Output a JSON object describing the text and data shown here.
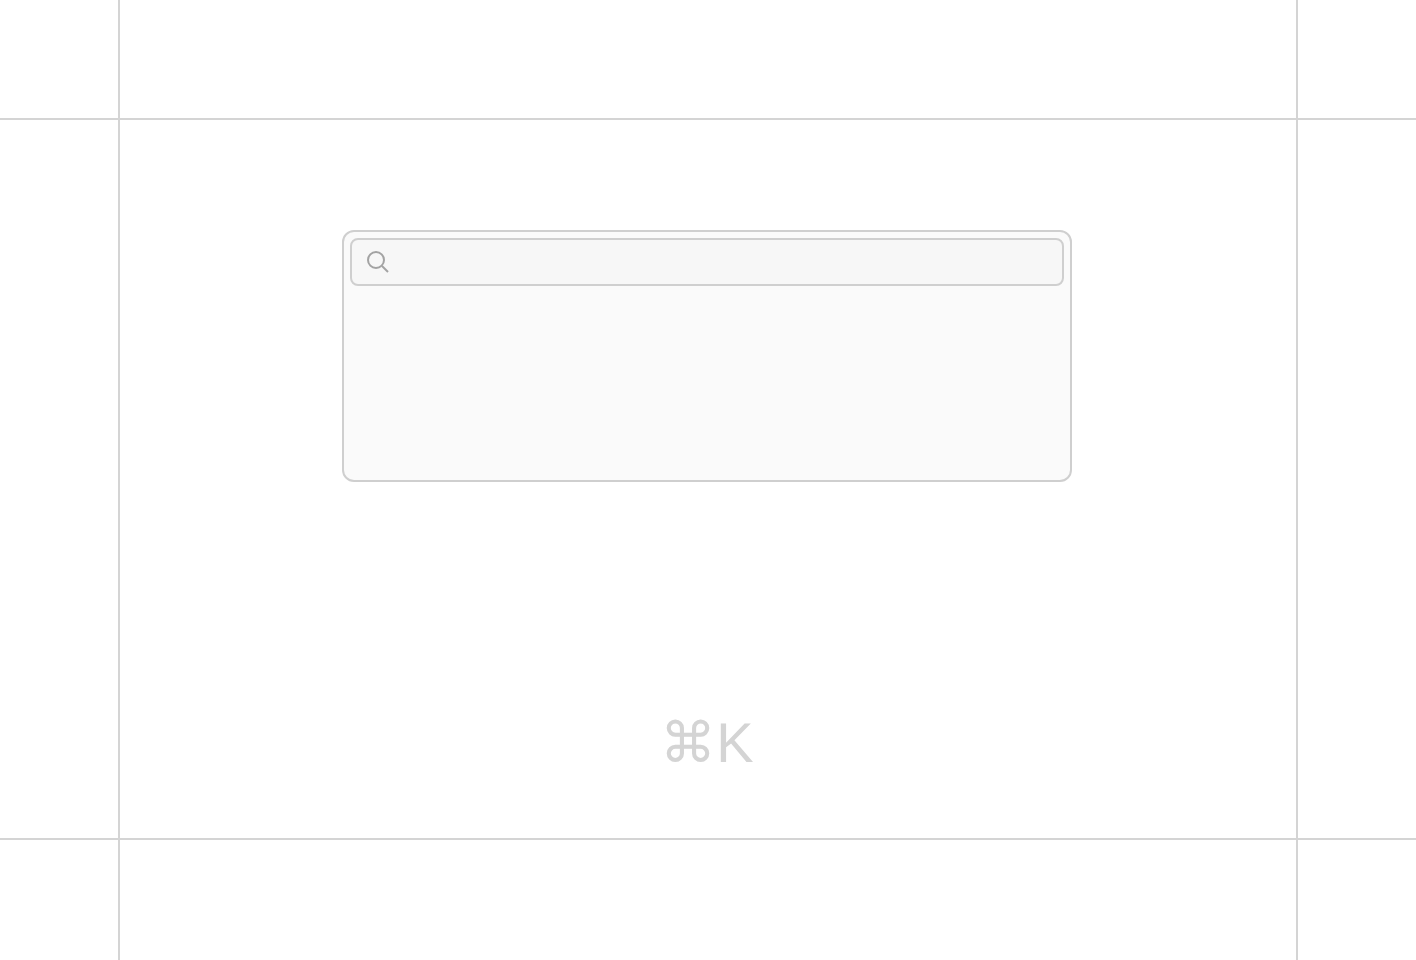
{
  "shortcut_hint": "⌘K"
}
